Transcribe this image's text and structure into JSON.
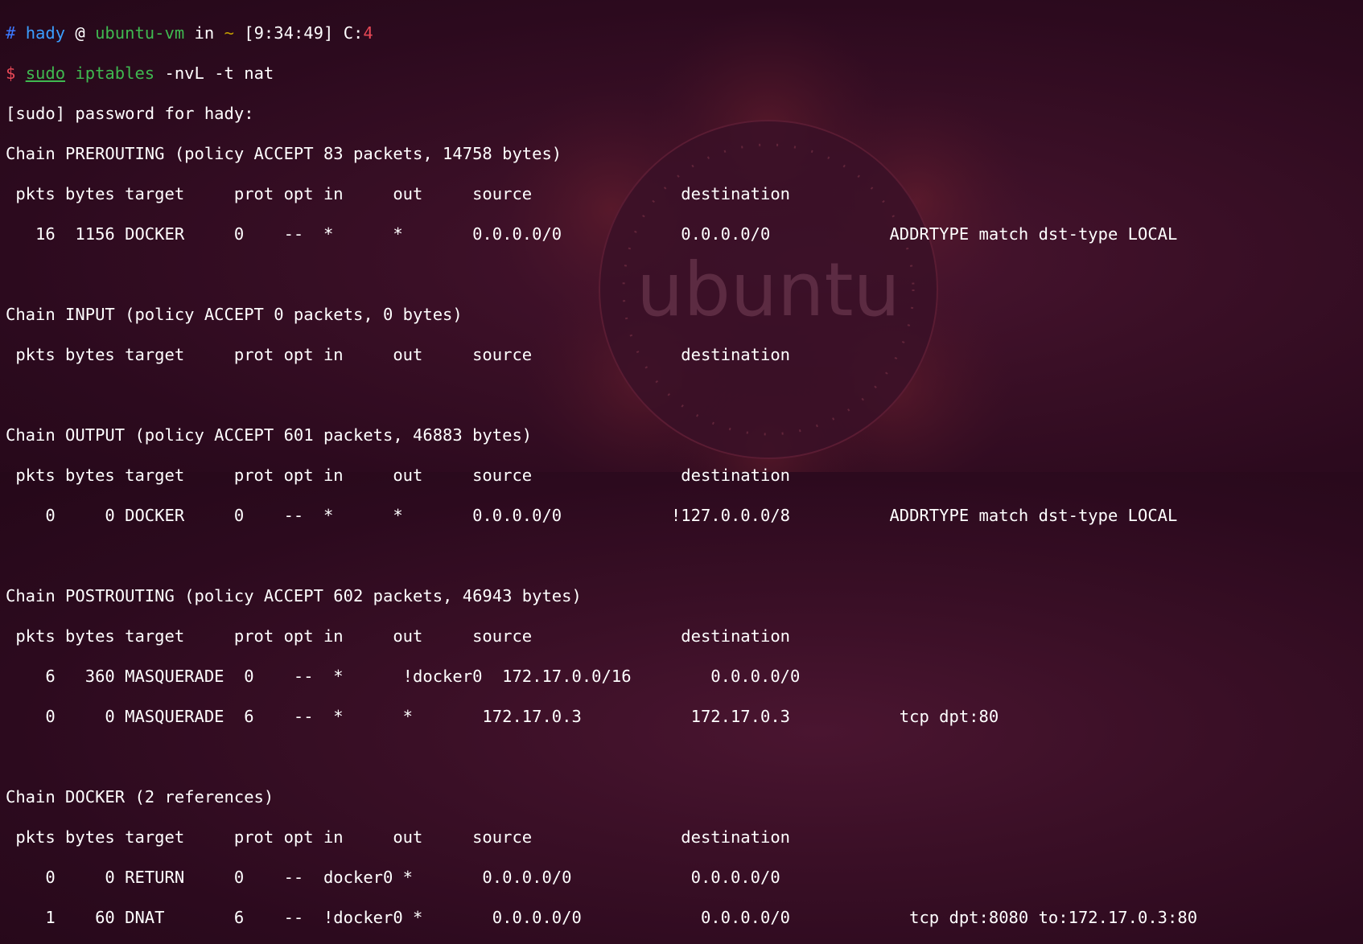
{
  "wallpaper": {
    "brand_text": "ubuntu",
    "background_color": "#2c0a1e",
    "accent_color": "#e95420"
  },
  "prompt": {
    "hash": "#",
    "user": "hady",
    "at": "@",
    "host": "ubuntu-vm",
    "in": "in",
    "dir": "~",
    "time": "[9:34:49]",
    "code_label": "C:",
    "code_value": "4",
    "dollar": "$",
    "cmd_sudo": "sudo",
    "cmd_iptables": "iptables",
    "cmd_args": "-nvL -t nat"
  },
  "lines": [
    "[sudo] password for hady:",
    "Chain PREROUTING (policy ACCEPT 83 packets, 14758 bytes)",
    " pkts bytes target     prot opt in     out     source               destination",
    "   16  1156 DOCKER     0    --  *      *       0.0.0.0/0            0.0.0.0/0            ADDRTYPE match dst-type LOCAL",
    "",
    "Chain INPUT (policy ACCEPT 0 packets, 0 bytes)",
    " pkts bytes target     prot opt in     out     source               destination",
    "",
    "Chain OUTPUT (policy ACCEPT 601 packets, 46883 bytes)",
    " pkts bytes target     prot opt in     out     source               destination",
    "    0     0 DOCKER     0    --  *      *       0.0.0.0/0           !127.0.0.0/8          ADDRTYPE match dst-type LOCAL",
    "",
    "Chain POSTROUTING (policy ACCEPT 602 packets, 46943 bytes)",
    " pkts bytes target     prot opt in     out     source               destination",
    "    6   360 MASQUERADE  0    --  *      !docker0  172.17.0.0/16        0.0.0.0/0",
    "    0     0 MASQUERADE  6    --  *      *       172.17.0.3           172.17.0.3           tcp dpt:80",
    "",
    "Chain DOCKER (2 references)",
    " pkts bytes target     prot opt in     out     source               destination",
    "    0     0 RETURN     0    --  docker0 *       0.0.0.0/0            0.0.0.0/0",
    "    1    60 DNAT       6    --  !docker0 *       0.0.0.0/0            0.0.0.0/0            tcp dpt:8080 to:172.17.0.3:80"
  ]
}
